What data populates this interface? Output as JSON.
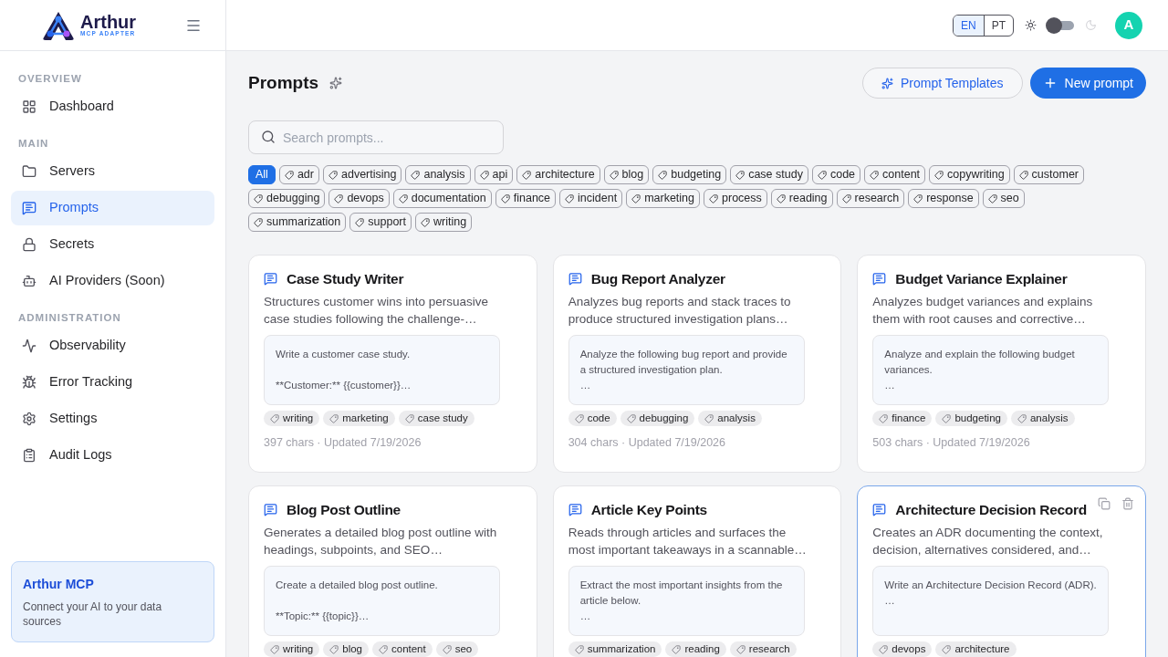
{
  "brand": {
    "name": "Arthur",
    "tagline": "MCP ADAPTER"
  },
  "sidebar": {
    "sections": [
      {
        "heading": "OVERVIEW",
        "items": [
          {
            "label": "Dashboard",
            "selected": false
          }
        ]
      },
      {
        "heading": "MAIN",
        "items": [
          {
            "label": "Servers",
            "selected": false
          },
          {
            "label": "Prompts",
            "selected": true
          },
          {
            "label": "Secrets",
            "selected": false
          },
          {
            "label": "AI Providers (Soon)",
            "selected": false
          }
        ]
      },
      {
        "heading": "ADMINISTRATION",
        "items": [
          {
            "label": "Observability",
            "selected": false
          },
          {
            "label": "Error Tracking",
            "selected": false
          },
          {
            "label": "Settings",
            "selected": false
          },
          {
            "label": "Audit Logs",
            "selected": false
          }
        ]
      }
    ],
    "promo": {
      "title": "Arthur MCP",
      "text": "Connect your AI to your data sources"
    }
  },
  "header": {
    "languages": [
      {
        "label": "EN",
        "selected": true
      },
      {
        "label": "PT",
        "selected": false
      }
    ],
    "dark_mode": false,
    "avatar": "A"
  },
  "page": {
    "title": "Prompts",
    "templates_button": "Prompt Templates",
    "new_button": "New prompt"
  },
  "search": {
    "placeholder": "Search prompts..."
  },
  "filters": [
    {
      "label": "All",
      "selected": true
    },
    {
      "label": "adr",
      "selected": false
    },
    {
      "label": "advertising",
      "selected": false
    },
    {
      "label": "analysis",
      "selected": false
    },
    {
      "label": "api",
      "selected": false
    },
    {
      "label": "architecture",
      "selected": false
    },
    {
      "label": "blog",
      "selected": false
    },
    {
      "label": "budgeting",
      "selected": false
    },
    {
      "label": "case study",
      "selected": false
    },
    {
      "label": "code",
      "selected": false
    },
    {
      "label": "content",
      "selected": false
    },
    {
      "label": "copywriting",
      "selected": false
    },
    {
      "label": "customer",
      "selected": false
    },
    {
      "label": "debugging",
      "selected": false
    },
    {
      "label": "devops",
      "selected": false
    },
    {
      "label": "documentation",
      "selected": false
    },
    {
      "label": "finance",
      "selected": false
    },
    {
      "label": "incident",
      "selected": false
    },
    {
      "label": "marketing",
      "selected": false
    },
    {
      "label": "process",
      "selected": false
    },
    {
      "label": "reading",
      "selected": false
    },
    {
      "label": "research",
      "selected": false
    },
    {
      "label": "response",
      "selected": false
    },
    {
      "label": "seo",
      "selected": false
    },
    {
      "label": "summarization",
      "selected": false
    },
    {
      "label": "support",
      "selected": false
    },
    {
      "label": "writing",
      "selected": false
    }
  ],
  "prompts": [
    {
      "title": "Case Study Writer",
      "description": "Structures customer wins into persuasive case studies following the challenge-…",
      "preview": "Write a customer case study.\n\n**Customer:** {{customer}}…",
      "tags": [
        "writing",
        "marketing",
        "case study"
      ],
      "meta": "397 chars · Updated 7/19/2026",
      "hovered": false
    },
    {
      "title": "Bug Report Analyzer",
      "description": "Analyzes bug reports and stack traces to produce structured investigation plans…",
      "preview": "Analyze the following bug report and provide a structured investigation plan.\n…",
      "tags": [
        "code",
        "debugging",
        "analysis"
      ],
      "meta": "304 chars · Updated 7/19/2026",
      "hovered": false
    },
    {
      "title": "Budget Variance Explainer",
      "description": "Analyzes budget variances and explains them with root causes and corrective…",
      "preview": "Analyze and explain the following budget variances.\n…",
      "tags": [
        "finance",
        "budgeting",
        "analysis"
      ],
      "meta": "503 chars · Updated 7/19/2026",
      "hovered": false
    },
    {
      "title": "Blog Post Outline",
      "description": "Generates a detailed blog post outline with headings, subpoints, and SEO…",
      "preview": "Create a detailed blog post outline.\n\n**Topic:** {{topic}}…",
      "tags": [
        "writing",
        "blog",
        "content",
        "seo"
      ],
      "hovered": false
    },
    {
      "title": "Article Key Points",
      "description": "Reads through articles and surfaces the most important takeaways in a scannable…",
      "preview": "Extract the most important insights from the article below.\n…",
      "tags": [
        "summarization",
        "reading",
        "research"
      ],
      "hovered": false
    },
    {
      "title": "Architecture Decision Record",
      "description": "Creates an ADR documenting the context, decision, alternatives considered, and…",
      "preview": "Write an Architecture Decision Record (ADR).\n…",
      "tags": [
        "devops",
        "architecture"
      ],
      "hovered": true
    }
  ]
}
